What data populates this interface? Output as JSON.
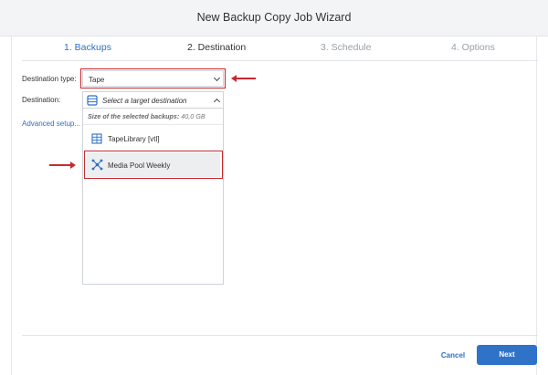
{
  "window": {
    "title": "New Backup Copy Job Wizard"
  },
  "steps": [
    {
      "label": "1. Backups"
    },
    {
      "label": "2. Destination"
    },
    {
      "label": "3. Schedule"
    },
    {
      "label": "4. Options"
    }
  ],
  "form": {
    "destination_type_label": "Destination type:",
    "destination_type_value": "Tape",
    "destination_label": "Destination:",
    "destination_placeholder": "Select a target destination",
    "advanced_setup_link": "Advanced setup..."
  },
  "dropdown": {
    "size_label": "Size of the selected backups:",
    "size_value": "40,0 GB",
    "items": [
      {
        "label": "TapeLibrary [vtl]",
        "icon": "tape-library-icon"
      },
      {
        "label": "Media Pool Weekly",
        "icon": "media-pool-icon"
      }
    ]
  },
  "footer": {
    "cancel_label": "Cancel",
    "next_label": "Next"
  },
  "colors": {
    "accent": "#2f73c8",
    "highlight": "#c8282e"
  }
}
